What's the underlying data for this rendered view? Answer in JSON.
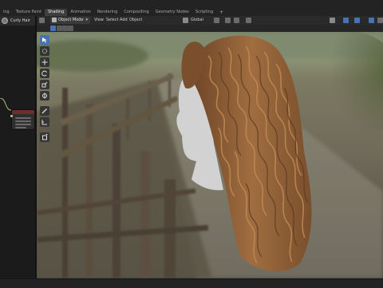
{
  "workspace_tabs": [
    {
      "label": "ing",
      "active": false
    },
    {
      "label": "Texture Paint",
      "active": false
    },
    {
      "label": "Shading",
      "active": true
    },
    {
      "label": "Animation",
      "active": false
    },
    {
      "label": "Rendering",
      "active": false
    },
    {
      "label": "Compositing",
      "active": false
    },
    {
      "label": "Geometry Nodes",
      "active": false
    },
    {
      "label": "Scripting",
      "active": false
    }
  ],
  "add_workspace_label": "+",
  "left_panel": {
    "object_name": "Curly Hair"
  },
  "viewport_header": {
    "mode": "Object Mode",
    "menus": [
      "View",
      "Select",
      "Add",
      "Object"
    ],
    "transform_orientation": "Global"
  },
  "toolbar_tools": [
    {
      "name": "select-tool",
      "icon": "cursor-arrow",
      "active": true
    },
    {
      "name": "cursor-tool",
      "icon": "3d-cursor",
      "active": false
    },
    {
      "name": "move-tool",
      "icon": "move-arrows",
      "active": false
    },
    {
      "name": "rotate-tool",
      "icon": "rotate",
      "active": false
    },
    {
      "name": "scale-tool",
      "icon": "scale",
      "active": false
    },
    {
      "name": "transform-tool",
      "icon": "transform",
      "active": false
    },
    {
      "name": "annotate-tool",
      "icon": "pencil",
      "active": false
    },
    {
      "name": "measure-tool",
      "icon": "ruler",
      "active": false
    },
    {
      "name": "add-cube-tool",
      "icon": "cube-add",
      "active": false
    }
  ],
  "colors": {
    "accent": "#4772b3",
    "hair": "#8a5a34",
    "mannequin": "#d2d2d2"
  }
}
